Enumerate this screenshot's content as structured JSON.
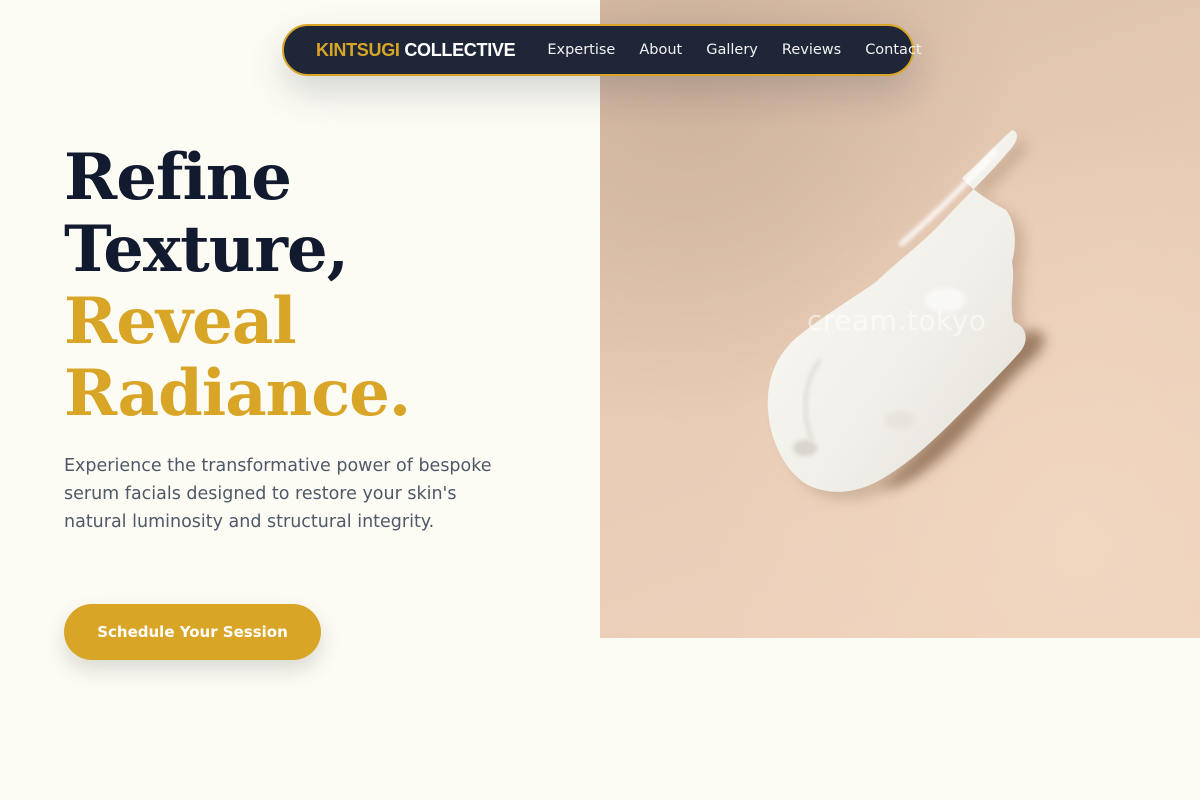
{
  "brand": {
    "part1": "KINTSUGI",
    "part2": "COLLECTIVE"
  },
  "nav": {
    "links": [
      "Expertise",
      "About",
      "Gallery",
      "Reviews",
      "Contact"
    ]
  },
  "hero": {
    "headline_line1": "Refine",
    "headline_line2": "Texture,",
    "headline_line3": "Reveal",
    "headline_line4": "Radiance.",
    "description": "Experience the transformative power of bespoke serum facials designed to restore your skin's natural luminosity and structural integrity.",
    "cta_label": "Schedule Your Session",
    "image": {
      "subject": "cream-swatch",
      "watermark": "cream.tokyo"
    }
  },
  "colors": {
    "background": "#fdfcf4",
    "navy": "#1e2638",
    "gold": "#d9a527",
    "headline_dark": "#111a2e",
    "body_text": "#4e5868"
  }
}
